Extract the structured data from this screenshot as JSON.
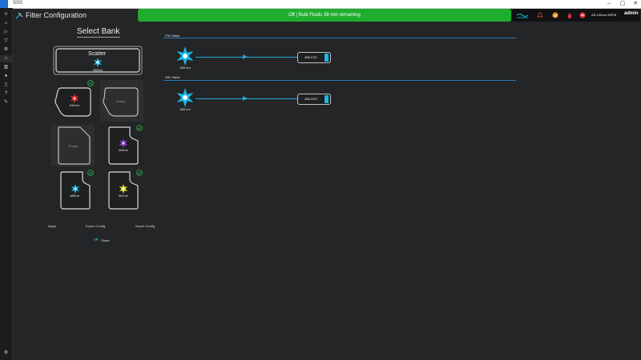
{
  "window": {
    "title": "SSS"
  },
  "header": {
    "title": "Filter Configuration"
  },
  "banner": {
    "text": "Off | Bulk Fluids 38 min remaining"
  },
  "status": {
    "device": "AS-100um-30PSI",
    "user": "admin"
  },
  "select_bank": {
    "title": "Select Bank"
  },
  "scatter": {
    "label": "Scatter",
    "wavelength": "488nm"
  },
  "lasers": [
    {
      "label": "640nm",
      "color": "#e8333a"
    },
    {
      "label": "Empty"
    },
    {
      "label": "Empty"
    },
    {
      "label": "405nm",
      "color": "#9b3ee0"
    },
    {
      "label": "488nm",
      "color": "#19b9e6"
    },
    {
      "label": "561nm",
      "color": "#f0e628"
    }
  ],
  "actions": {
    "apply": "Apply",
    "export": "Export Config",
    "import": "Import Config",
    "share": "Share"
  },
  "banks": [
    {
      "title": "FSC Bank",
      "source": "488 nm",
      "filter": "488-FSC"
    },
    {
      "title": "SSC Bank",
      "source": "488 nm",
      "filter": "488-SSC"
    }
  ],
  "colors": {
    "accent": "#19b9e6",
    "banner": "#1fad2f",
    "check": "#2fbf55",
    "line": "#2b7bb5"
  }
}
